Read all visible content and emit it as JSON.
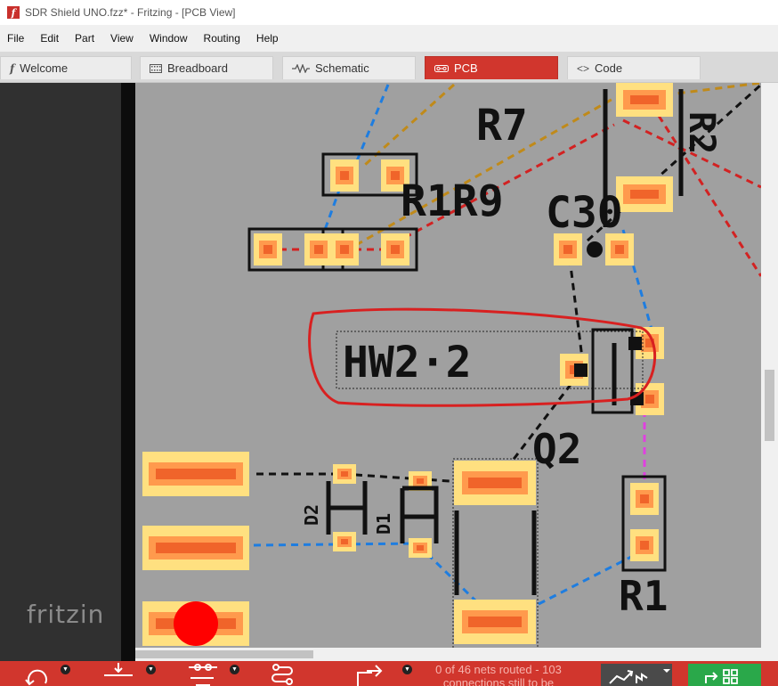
{
  "window": {
    "title": "SDR Shield UNO.fzz* - Fritzing - [PCB View]",
    "app_icon": "f"
  },
  "menu": {
    "items": [
      "File",
      "Edit",
      "Part",
      "View",
      "Window",
      "Routing",
      "Help"
    ]
  },
  "tabs": [
    {
      "label": "Welcome",
      "icon": "fritzing-f-icon",
      "active": false
    },
    {
      "label": "Breadboard",
      "icon": "breadboard-icon",
      "active": false
    },
    {
      "label": "Schematic",
      "icon": "resistor-symbol-icon",
      "active": false
    },
    {
      "label": "PCB",
      "icon": "pcb-icon",
      "active": true
    },
    {
      "label": "Code",
      "icon": "code-brackets-icon",
      "active": false
    }
  ],
  "pcb": {
    "labels": {
      "r7": "R7",
      "r1r9": "R1R9",
      "c30": "C30",
      "hw": "HW2·2",
      "q2": "Q2",
      "r1": "R1",
      "d2": "D2",
      "d1": "D1",
      "r2_partial": "R2"
    },
    "colors": {
      "board": "#a0a0a0",
      "pad_outer": "#ffe080",
      "pad_ring": "#ff9a4d",
      "pad_core": "#f0642a",
      "ratsnest_blue": "#1e7de0",
      "ratsnest_red": "#d22222",
      "ratsnest_gold": "#c08a1a",
      "ratsnest_magenta": "#e040e0",
      "highlight_circle": "#d82020",
      "silkscreen": "#111111",
      "marker_dot": "#ff0000"
    }
  },
  "watermark": "fritzin",
  "status": {
    "line1": "0 of 46 nets routed - 103",
    "line2": "connections still to be"
  },
  "toolbar": {
    "buttons": [
      "rotate-icon",
      "place-icon",
      "align-icon",
      "route-icon",
      "export-icon"
    ],
    "autoroute_icon": "autoroute-icon",
    "share_icon": "share-icon"
  },
  "theme": {
    "accent": "#d1362d",
    "share_green": "#2aa84a"
  }
}
